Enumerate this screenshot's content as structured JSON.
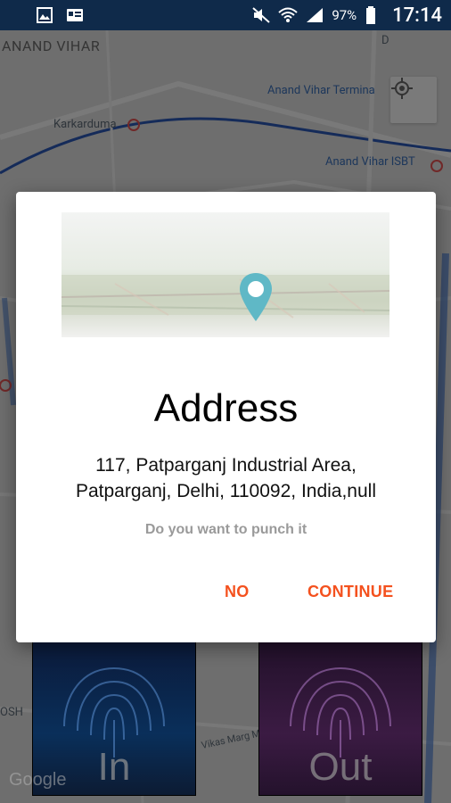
{
  "status_bar": {
    "battery": "97%",
    "time": "17:14"
  },
  "map": {
    "labels": {
      "anand_vihar": "ANAND VIHAR",
      "anand_vihar_terminal": "Anand Vihar Termina",
      "karkarduma": "Karkarduma",
      "anand_vihar_isbt": "Anand Vihar ISBT",
      "d": "D",
      "osh": "OSH",
      "main_rd": "Vikas Marg Main Rd"
    },
    "google_logo": "Google"
  },
  "punch": {
    "in_label": "In",
    "out_label": "Out"
  },
  "dialog": {
    "title": "Address",
    "address_line1": "117, Patparganj Industrial Area,",
    "address_line2": "Patparganj, Delhi, 110092, India,null",
    "question": "Do you want to punch it",
    "no_label": "NO",
    "continue_label": "CONTINUE"
  },
  "colors": {
    "accent": "#f4511e",
    "status_bar": "#0f2a4a",
    "pin": "#5fb8c6"
  }
}
